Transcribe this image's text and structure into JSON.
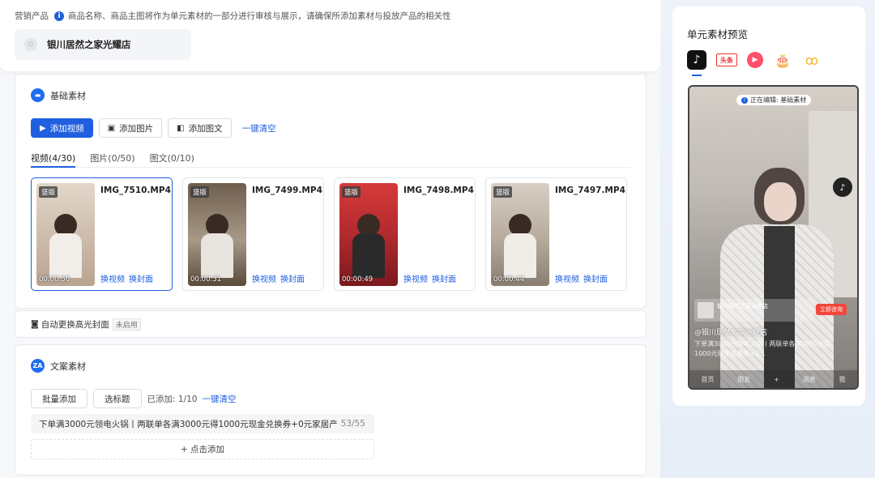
{
  "header": {
    "label": "营销产品",
    "notice": "商品名称、商品主图将作为单元素材的一部分进行审核与展示，请确保所添加素材与投放产品的相关性",
    "store_name": "银川居然之家光耀店"
  },
  "base_material": {
    "title": "基础素材",
    "buttons": {
      "add_video": "添加视频",
      "add_image": "添加图片",
      "add_graphic": "添加图文",
      "clear": "一键清空"
    },
    "tabs": [
      {
        "label": "视频(4/30)",
        "active": true
      },
      {
        "label": "图片(0/50)",
        "active": false
      },
      {
        "label": "图文(0/10)",
        "active": false
      }
    ],
    "videos": [
      {
        "name": "IMG_7510.MP4",
        "tag": "竖版",
        "duration": "00:00:56",
        "replace_video": "换视频",
        "replace_cover": "换封面",
        "selected": true,
        "color": "#c9b9a9"
      },
      {
        "name": "IMG_7499.MP4",
        "tag": "竖版",
        "duration": "00:00:31",
        "replace_video": "换视频",
        "replace_cover": "换封面",
        "selected": false,
        "color": "#7a6a5a"
      },
      {
        "name": "IMG_7498.MP4",
        "tag": "竖版",
        "duration": "00:00:49",
        "replace_video": "换视频",
        "replace_cover": "换封面",
        "selected": false,
        "color": "#c4323a"
      },
      {
        "name": "IMG_7497.MP4",
        "tag": "竖版",
        "duration": "00:00:44",
        "replace_video": "换视频",
        "replace_cover": "换封面",
        "selected": false,
        "color": "#bfb2a4"
      }
    ]
  },
  "auto_cover": {
    "label": "自动更换高光封面",
    "status": "未启用"
  },
  "copy_material": {
    "title": "文案素材",
    "batch_add": "批量添加",
    "select_title": "选标题",
    "added_label": "已添加: 1/10",
    "clear": "一键清空",
    "copies": [
      {
        "text": "下单满3000元领电火锅丨两联单各满3000元得1000元现金兑换券+0元家居产",
        "count": "53/55"
      }
    ],
    "add_more": "+ 点击添加"
  },
  "preview": {
    "title": "单元素材预览",
    "platforms": [
      {
        "name": "tiktok-icon",
        "label": "♪"
      },
      {
        "name": "toutiao-icon",
        "label": "头条"
      },
      {
        "name": "xigua-icon",
        "label": "▶"
      },
      {
        "name": "huoshan-icon",
        "label": "🎂"
      },
      {
        "name": "other-app-icon",
        "label": "ꝏ"
      }
    ],
    "editing_badge": "正在编辑: 基础素材",
    "store_name": "银川居然之家光耀店",
    "cta": "立即咨询",
    "caption_name": "@银川居然之家光耀店",
    "caption_text": "下单满3000元领电火锅丨两联单各满3000元得1000元现金兑换券+0...",
    "bottom_items": [
      "首页",
      "朋友",
      "+",
      "消息",
      "我"
    ]
  },
  "colors": {
    "primary": "#1f5fe0",
    "danger": "#f0473a"
  }
}
